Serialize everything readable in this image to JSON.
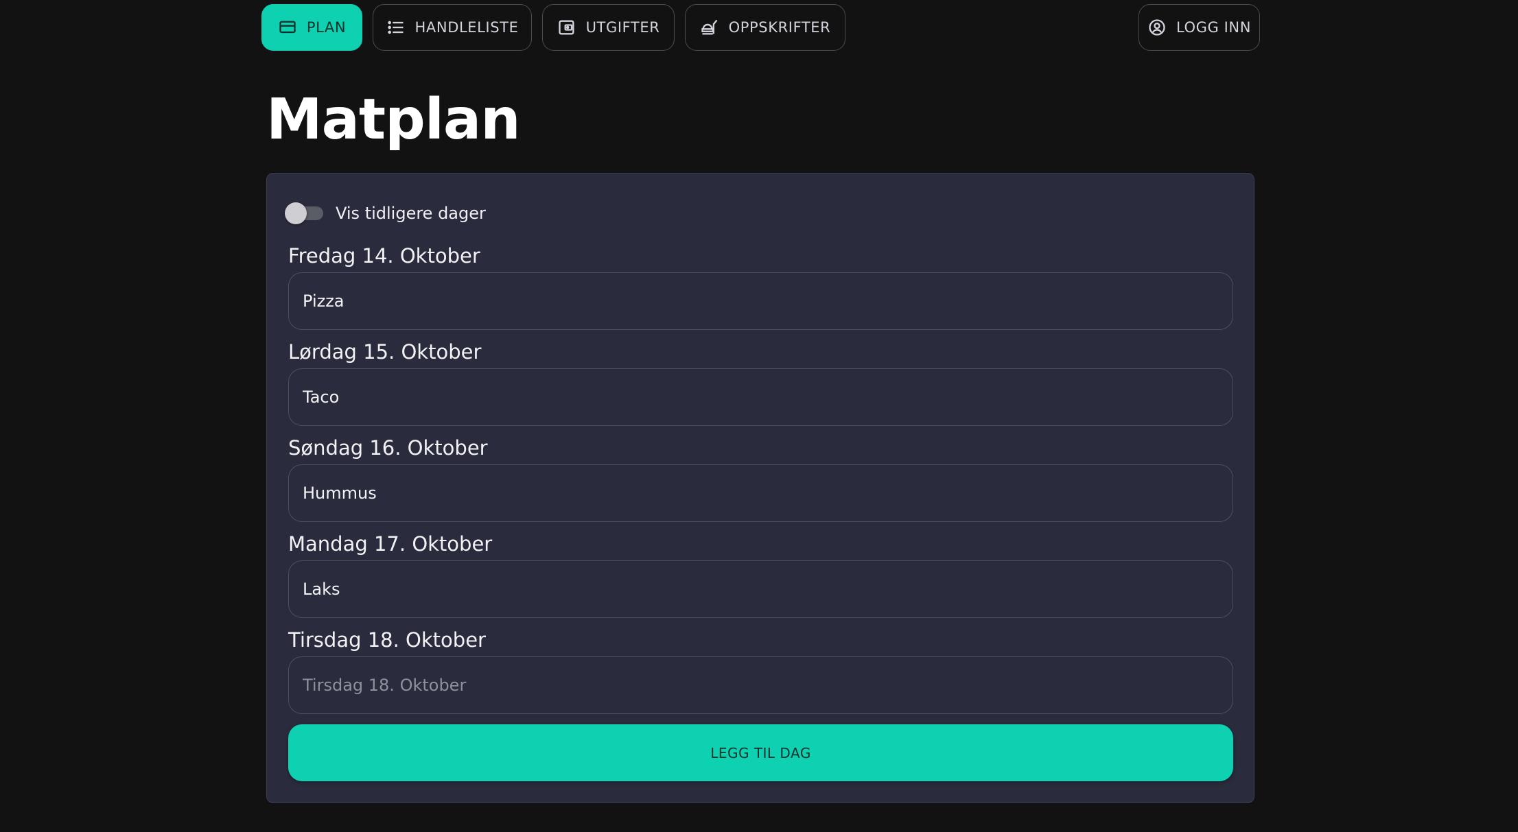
{
  "nav": {
    "plan": {
      "label": "PLAN",
      "icon": "plan-icon"
    },
    "handleliste": {
      "label": "HANDLELISTE",
      "icon": "list-icon"
    },
    "utgifter": {
      "label": "UTGIFTER",
      "icon": "wallet-icon"
    },
    "oppskrifter": {
      "label": "OPPSKRIFTER",
      "icon": "food-icon"
    },
    "login": {
      "label": "LOGG INN",
      "icon": "user-circle-icon"
    }
  },
  "page": {
    "title": "Matplan"
  },
  "toggle": {
    "label": "Vis tidligere dager",
    "checked": false
  },
  "days": [
    {
      "label": "Fredag 14. Oktober",
      "value": "Pizza",
      "placeholder": "Fredag 14. Oktober"
    },
    {
      "label": "Lørdag 15. Oktober",
      "value": "Taco",
      "placeholder": "Lørdag 15. Oktober"
    },
    {
      "label": "Søndag 16. Oktober",
      "value": "Hummus",
      "placeholder": "Søndag 16. Oktober"
    },
    {
      "label": "Mandag 17. Oktober",
      "value": "Laks",
      "placeholder": "Mandag 17. Oktober"
    },
    {
      "label": "Tirsdag 18. Oktober",
      "value": "",
      "placeholder": "Tirsdag 18. Oktober"
    }
  ],
  "add_day": {
    "label": "LEGG TIL DAG"
  },
  "colors": {
    "accent": "#0dd1b0",
    "background": "#121213",
    "card": "#2a2c3d"
  }
}
